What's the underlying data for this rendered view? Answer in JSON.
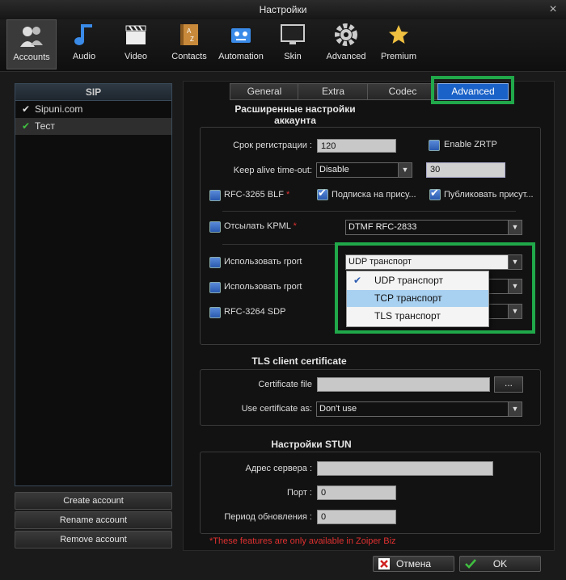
{
  "window": {
    "title": "Настройки"
  },
  "toolbar": {
    "items": [
      {
        "label": "Accounts",
        "icon": "accounts-icon"
      },
      {
        "label": "Audio",
        "icon": "music-note-icon"
      },
      {
        "label": "Video",
        "icon": "clapperboard-icon"
      },
      {
        "label": "Contacts",
        "icon": "address-book-icon"
      },
      {
        "label": "Automation",
        "icon": "robot-icon"
      },
      {
        "label": "Skin",
        "icon": "monitor-icon"
      },
      {
        "label": "Advanced",
        "icon": "gear-icon"
      },
      {
        "label": "Premium",
        "icon": "star-icon"
      }
    ]
  },
  "sidebar": {
    "header": "SIP",
    "accounts": [
      {
        "check": "✔",
        "name": "Sipuni.com"
      },
      {
        "check": "✔",
        "name": "Тест"
      }
    ],
    "buttons": {
      "create": "Create account",
      "rename": "Rename account",
      "remove": "Remove account"
    }
  },
  "tabs": [
    "General",
    "Extra",
    "Codec",
    "Advanced"
  ],
  "advanced": {
    "heading": "Расширенные настройки аккаунта",
    "reg_label": "Срок регистрации :",
    "reg_value": "120",
    "zrtp_label": "Enable ZRTP",
    "keepalive_label": "Keep alive time-out:",
    "keepalive_value": "Disable",
    "keepalive_seconds": "30",
    "blf_label": "RFC-3265 BLF",
    "star": "*",
    "subscribe_label": "Подписка на прису...",
    "publish_label": "Публиковать присут...",
    "kpml_label": "Отсылать KPML",
    "dtmf_value": "DTMF RFC-2833",
    "rport1_label": "Использовать rport",
    "transport_value": "UDP транспорт",
    "rport2_label": "Использовать rport",
    "sdp_label": "RFC-3264 SDP",
    "dropdown": {
      "items": [
        "UDP транспорт",
        "TCP транспорт",
        "TLS транспорт"
      ],
      "checked_mark": "✔"
    }
  },
  "tls": {
    "heading": "TLS client certificate",
    "cert_label": "Certificate file",
    "browse_label": "...",
    "use_label": "Use certificate as:",
    "use_value": "Don't use"
  },
  "stun": {
    "heading": "Настройки STUN",
    "server_label": "Адрес сервера :",
    "port_label": "Порт :",
    "port_value": "0",
    "refresh_label": "Период обновления :",
    "refresh_value": "0"
  },
  "footer_note": "*These features are only available in Zoiper Biz",
  "buttons": {
    "cancel": "Отмена",
    "ok": "OK"
  },
  "colors": {
    "accent": "#1a62c8",
    "highlight_box": "#20a84a",
    "note": "#e03030"
  }
}
